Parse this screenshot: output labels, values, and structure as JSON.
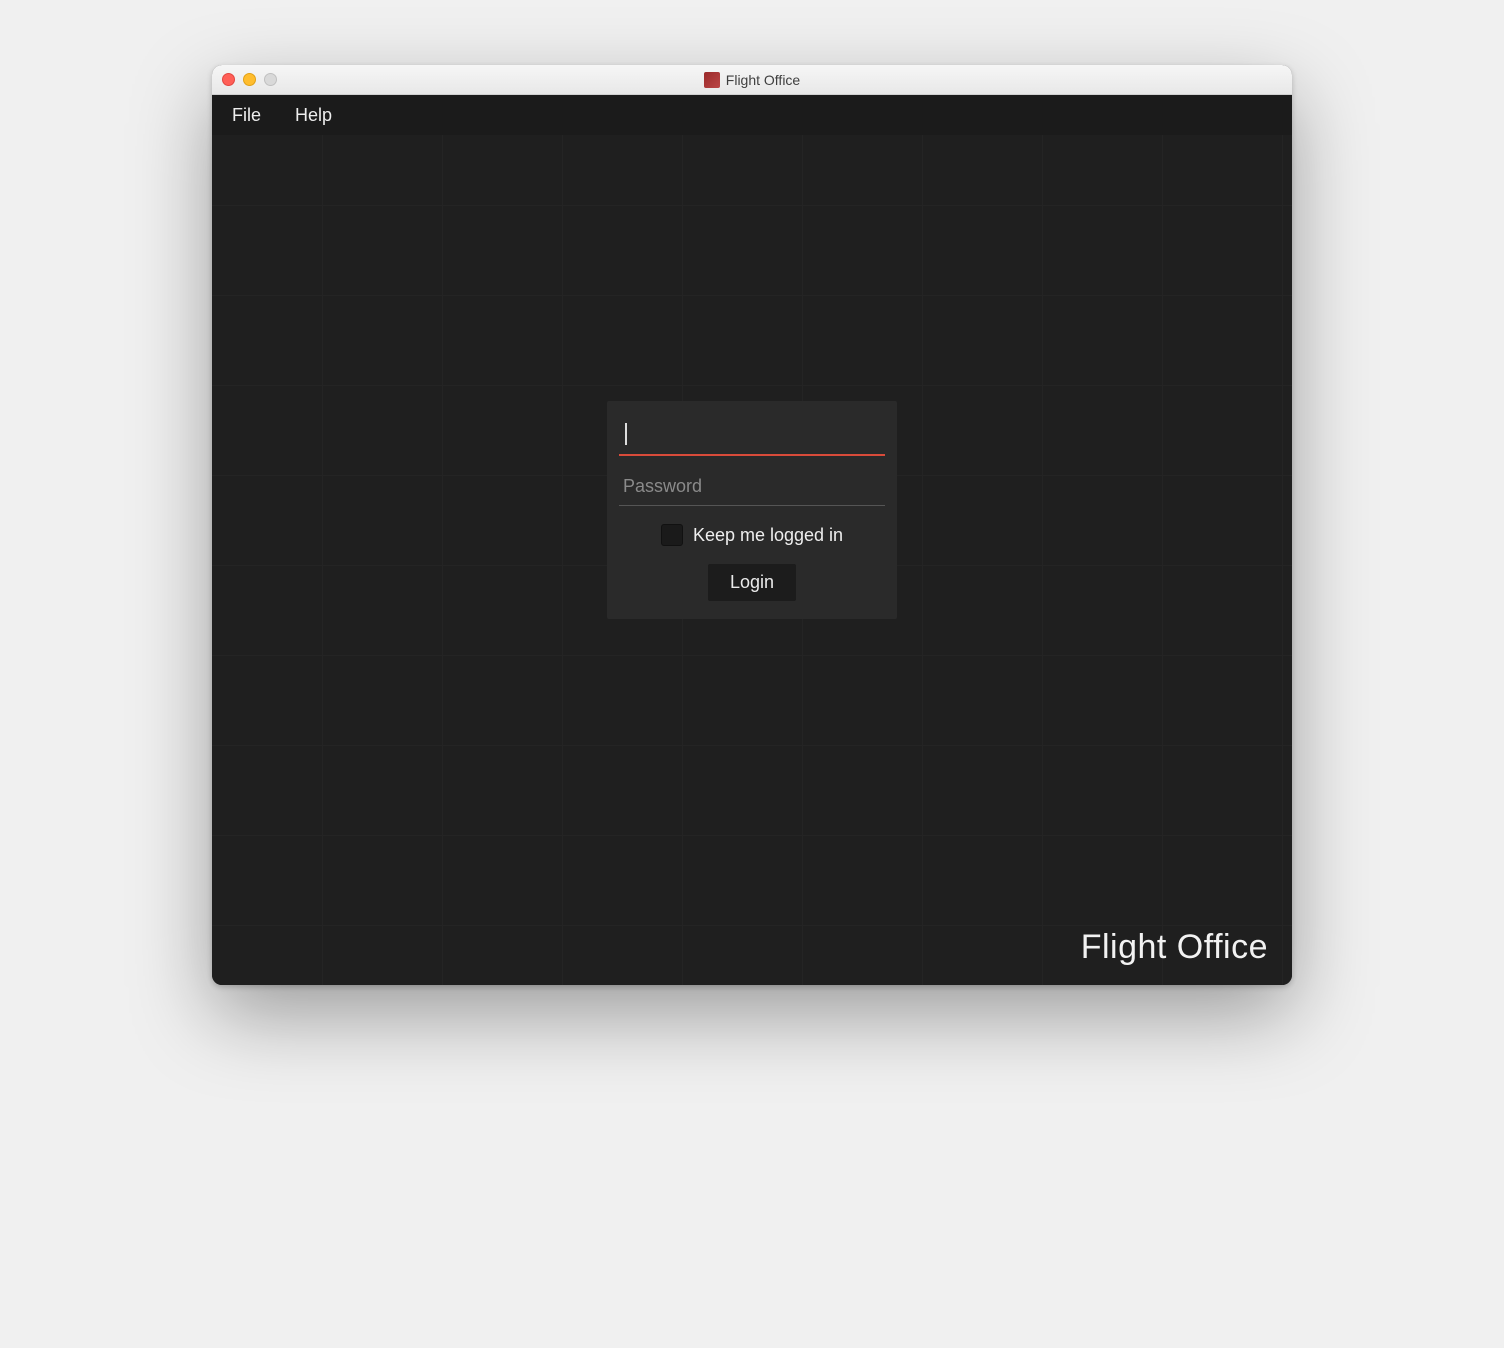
{
  "window": {
    "title": "Flight Office"
  },
  "menubar": {
    "items": [
      "File",
      "Help"
    ]
  },
  "login": {
    "username_value": "",
    "password_value": "",
    "password_placeholder": "Password",
    "keep_logged_in_label": "Keep me logged in",
    "keep_logged_in_checked": false,
    "login_button": "Login"
  },
  "brand": {
    "name": "Flight Office"
  },
  "colors": {
    "accent": "#d94b3a",
    "background": "#1f1f1f",
    "panel": "#2a2a2a"
  }
}
